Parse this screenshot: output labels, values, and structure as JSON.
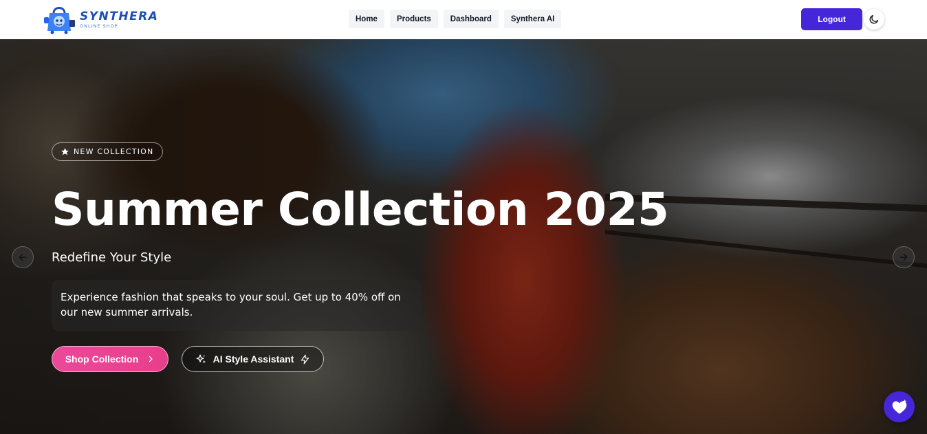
{
  "brand": {
    "name": "SYNTHERA",
    "tagline": "ONLINE SHOP",
    "logo_icon": "shopping-bag-robot-logo"
  },
  "nav": {
    "links": [
      "Home",
      "Products",
      "Dashboard",
      "Synthera AI"
    ],
    "logout_label": "Logout",
    "theme_toggle_icon": "moon-icon"
  },
  "hero": {
    "badge": "NEW COLLECTION",
    "badge_icon": "star-icon",
    "title": "Summer Collection 2025",
    "subtitle": "Redefine Your Style",
    "description": "Experience fashion that speaks to your soul. Get up to 40% off on our new summer arrivals.",
    "primary_cta": "Shop Collection",
    "primary_cta_icon": "chevron-right-icon",
    "secondary_cta": "AI Style Assistant",
    "secondary_cta_icons": [
      "sparkles-icon",
      "lightning-icon"
    ],
    "prev_icon": "arrow-left-icon",
    "next_icon": "arrow-right-icon"
  },
  "chat_fab_icon": "chat-heart-icon",
  "colors": {
    "accent": "#4527d9",
    "pink": "#ec4899",
    "logo_blue": "#1e4fb8"
  }
}
